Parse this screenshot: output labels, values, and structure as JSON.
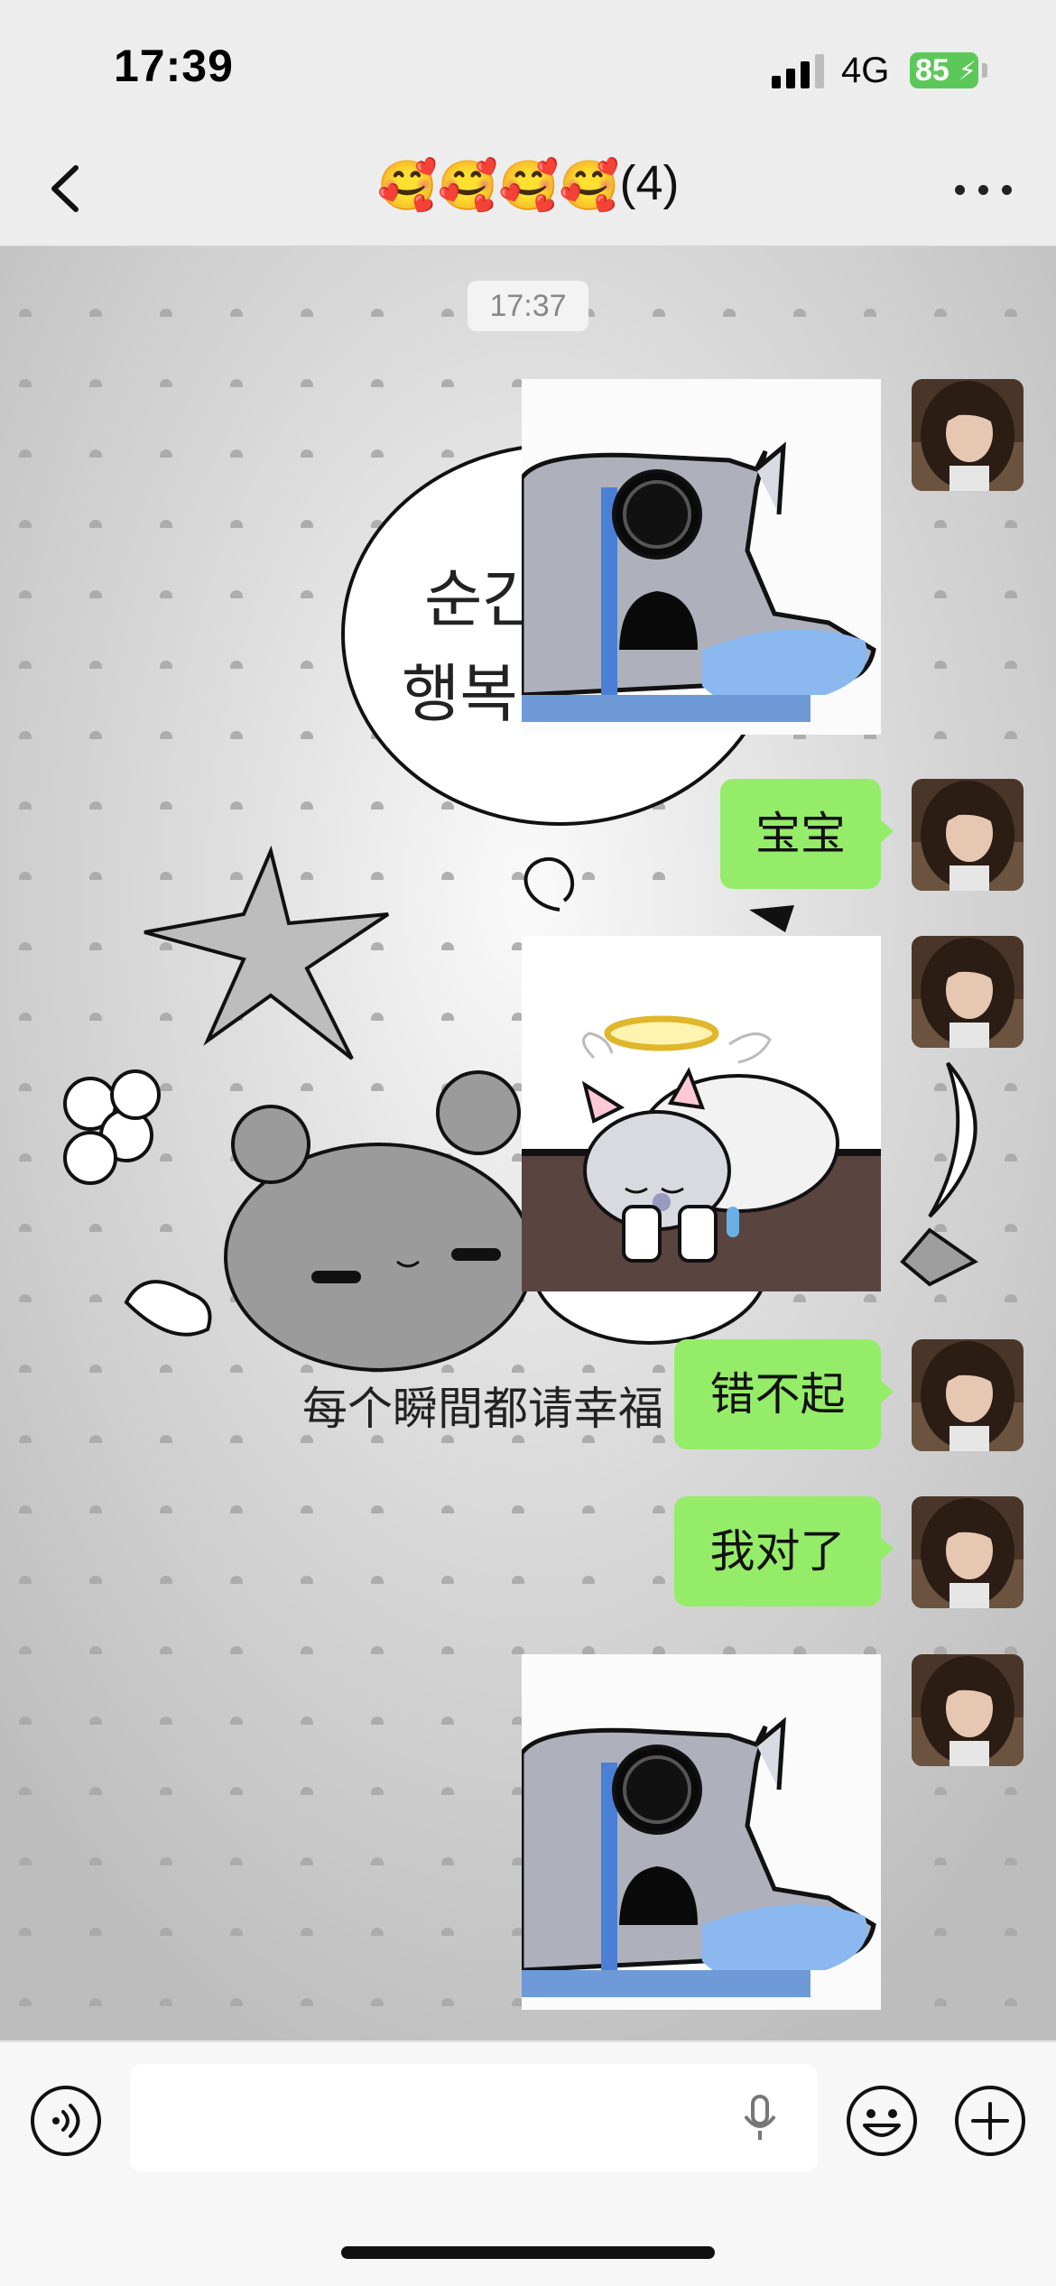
{
  "status_bar": {
    "time": "17:39",
    "network": "4G",
    "battery": "85",
    "battery_color": "#5dc85a"
  },
  "nav": {
    "title_emojis": [
      "🥰",
      "🥰",
      "🥰",
      "🥰"
    ],
    "member_count": "(4)",
    "back_icon": "chevron-left-icon",
    "more_icon": "more-dots-icon"
  },
  "chat": {
    "timestamp": "17:37",
    "wallpaper_texts": [
      "순간",
      "행복",
      "每个瞬間都请幸福"
    ],
    "messages": [
      {
        "type": "sticker",
        "sticker": "crying-cat-sticker"
      },
      {
        "type": "text",
        "text": "宝宝"
      },
      {
        "type": "sticker",
        "sticker": "angel-cat-sticker"
      },
      {
        "type": "text",
        "text": "错不起"
      },
      {
        "type": "text",
        "text": "我对了"
      },
      {
        "type": "sticker",
        "sticker": "crying-cat-sticker"
      }
    ],
    "bubble_color": "#95ec69"
  },
  "input_bar": {
    "placeholder": "",
    "icons": [
      "voice-icon",
      "microphone-icon",
      "emoji-icon",
      "plus-icon"
    ]
  }
}
